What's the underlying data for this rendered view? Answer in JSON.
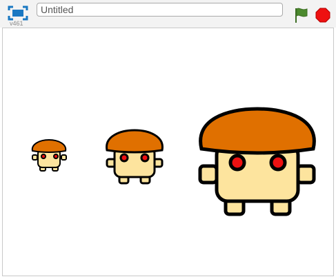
{
  "toolbar": {
    "version_label": "v461",
    "title_value": "Untitled",
    "icons": {
      "fullscreen": "fullscreen-icon",
      "green_flag": "green-flag-icon",
      "stop": "stop-sign-icon"
    },
    "colors": {
      "fullscreen": "#1a78c2",
      "flag": "#4c8a2e",
      "stop": "#ee1111"
    }
  },
  "stage": {
    "sprites": [
      {
        "name": "mushroom-character",
        "size": "small"
      },
      {
        "name": "mushroom-character",
        "size": "medium"
      },
      {
        "name": "mushroom-character",
        "size": "large"
      }
    ],
    "colors": {
      "cap": "#e07000",
      "body": "#fde49e",
      "eyes": "#ee1111",
      "outline": "#000000"
    }
  }
}
